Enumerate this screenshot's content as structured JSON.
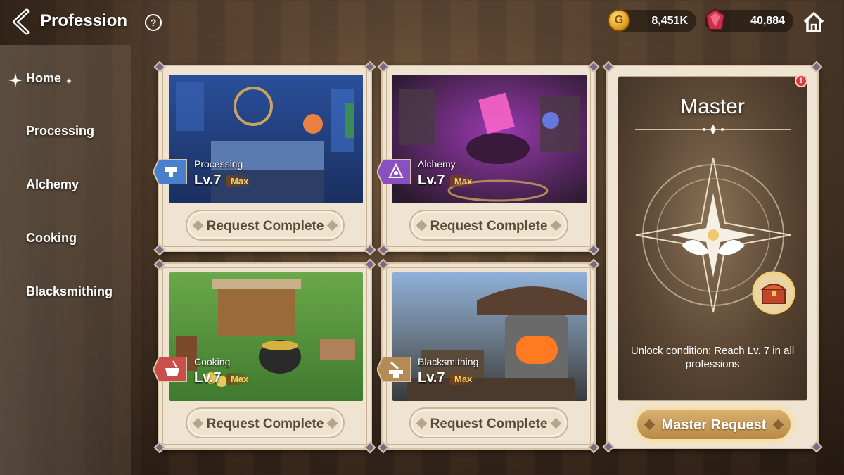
{
  "header": {
    "title": "Profession",
    "gold_amount": "8,451K",
    "gem_amount": "40,884",
    "coin_glyph": "G",
    "icons": {
      "back": "back-arrow-icon",
      "help": "help-icon",
      "gold": "gold-coin-icon",
      "gem": "gem-icon",
      "home": "home-icon"
    }
  },
  "sidebar": {
    "items": [
      {
        "label": "Home",
        "active": true
      },
      {
        "label": "Processing"
      },
      {
        "label": "Alchemy"
      },
      {
        "label": "Cooking"
      },
      {
        "label": "Blacksmithing"
      }
    ]
  },
  "cards": [
    {
      "name": "Processing",
      "level": "Lv.7",
      "max": "Max",
      "button": "Request Complete",
      "icon": "anvil-icon",
      "accent": "#4a7fcf"
    },
    {
      "name": "Alchemy",
      "level": "Lv.7",
      "max": "Max",
      "button": "Request Complete",
      "icon": "alchemy-circle-icon",
      "accent": "#8a4fc0"
    },
    {
      "name": "Cooking",
      "level": "Lv.7",
      "max": "Max",
      "button": "Request Complete",
      "icon": "cooking-pot-icon",
      "accent": "#c9504a"
    },
    {
      "name": "Blacksmithing",
      "level": "Lv.7",
      "max": "Max",
      "button": "Request Complete",
      "icon": "hammer-anvil-icon",
      "accent": "#b58a55"
    }
  ],
  "master": {
    "title": "Master",
    "unlock_text": "Unlock condition: Reach Lv. 7 in all professions",
    "button": "Master Request",
    "alert": "!"
  },
  "colors": {
    "card_bg": "#efe4d2",
    "button_text": "#5d4a37",
    "max_gold": "#ffcf5a",
    "master_button": "#c99e58"
  }
}
